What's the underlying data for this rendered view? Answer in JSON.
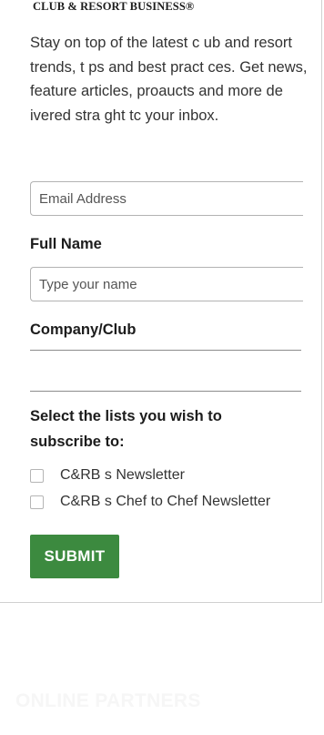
{
  "brand": {
    "name": "CLUB & RESORT BUSINESS®"
  },
  "intro": {
    "text": "Stay on top of the latest c ub and resort trends, t ps and best pract ces. Get news, feature articles, proaucts and more de ivered stra ght tc your inbox."
  },
  "form": {
    "email_placeholder": "Email Address",
    "full_name_label": "Full Name",
    "name_placeholder": "Type your name",
    "company_label": "Company/Club",
    "lists_title": "Select the lists you wish to subscribe to:",
    "options": [
      {
        "label": "C&RB s Newsletter",
        "checked": false
      },
      {
        "label": "C&RB s Chef to Chef Newsletter",
        "checked": false
      }
    ],
    "submit_label": "SUBMIT"
  },
  "footer": {
    "section_title": "ONLINE PARTNERS"
  },
  "colors": {
    "submit_bg": "#3c8a3f",
    "border": "#b3b3b3"
  }
}
